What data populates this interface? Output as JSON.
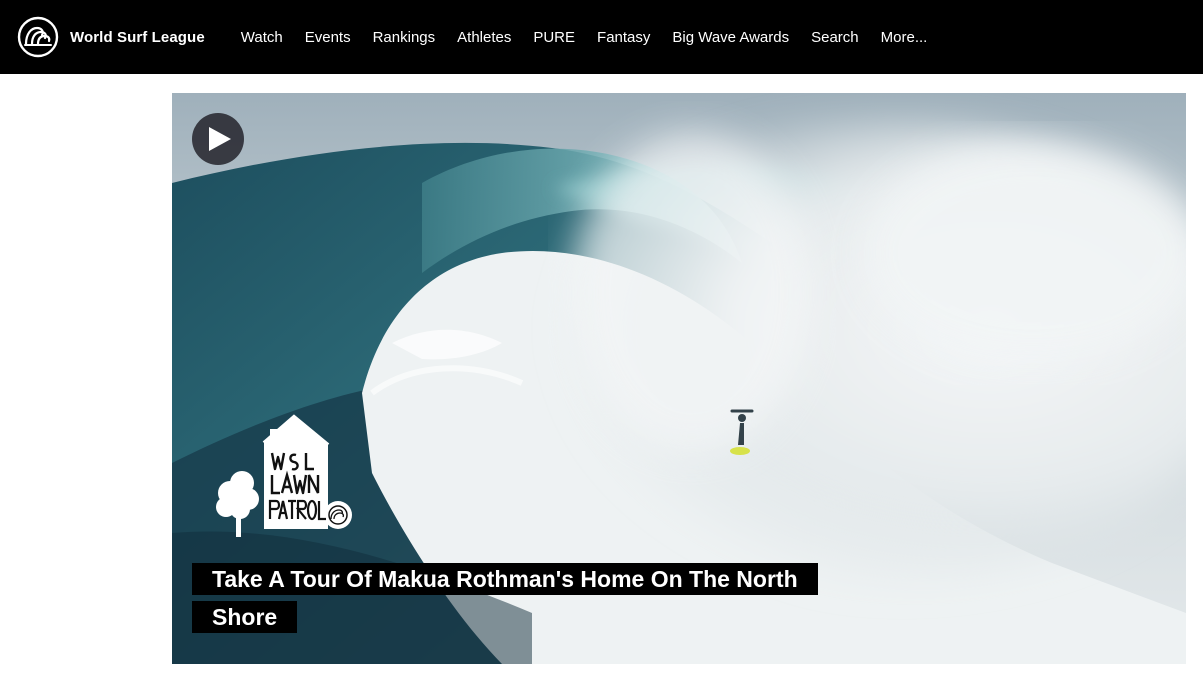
{
  "brand": {
    "name": "World Surf League",
    "logo_icon": "wsl-wave-logo-icon"
  },
  "nav": {
    "items": [
      {
        "label": "Watch"
      },
      {
        "label": "Events"
      },
      {
        "label": "Rankings"
      },
      {
        "label": "Athletes"
      },
      {
        "label": "PURE"
      },
      {
        "label": "Fantasy"
      },
      {
        "label": "Big Wave Awards"
      },
      {
        "label": "Search"
      },
      {
        "label": "More..."
      }
    ]
  },
  "hero": {
    "play_icon": "play-icon",
    "series_logo_text": "WSL LAWN PATROL",
    "title": "Take A Tour Of Makua Rothman's Home On The North Shore"
  },
  "colors": {
    "nav_background": "#000000",
    "text": "#ffffff",
    "title_background": "#000000",
    "play_button": "#2a2a30"
  }
}
